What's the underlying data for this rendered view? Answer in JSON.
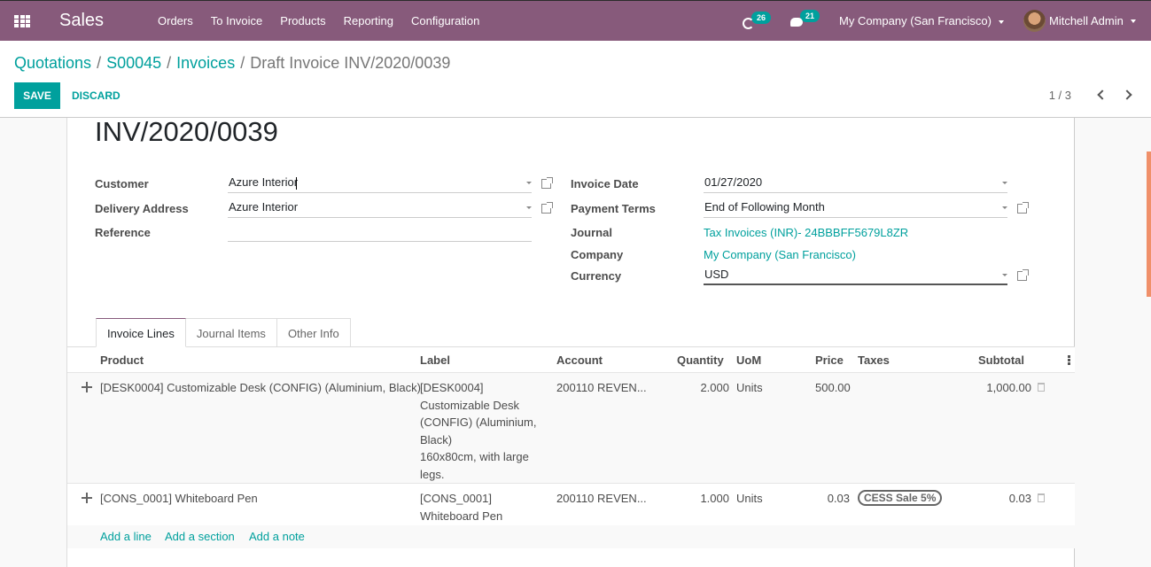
{
  "navbar": {
    "app_name": "Sales",
    "menu": [
      "Orders",
      "To Invoice",
      "Products",
      "Reporting",
      "Configuration"
    ],
    "activity_count": "26",
    "messages_count": "21",
    "company": "My Company (San Francisco)",
    "user": "Mitchell Admin"
  },
  "breadcrumb": {
    "items": [
      "Quotations",
      "S00045",
      "Invoices"
    ],
    "current": "Draft Invoice INV/2020/0039"
  },
  "toolbar": {
    "save_label": "SAVE",
    "discard_label": "DISCARD",
    "pager": "1 / 3"
  },
  "invoice": {
    "number": "INV/2020/0039",
    "left_fields": {
      "customer_label": "Customer",
      "customer_value": "Azure Interior",
      "delivery_label": "Delivery Address",
      "delivery_value": "Azure Interior",
      "reference_label": "Reference",
      "reference_value": ""
    },
    "right_fields": {
      "invoice_date_label": "Invoice Date",
      "invoice_date_value": "01/27/2020",
      "payment_terms_label": "Payment Terms",
      "payment_terms_value": "End of Following Month",
      "journal_label": "Journal",
      "journal_value": "Tax Invoices (INR)- 24BBBFF5679L8ZR",
      "company_label": "Company",
      "company_value": "My Company (San Francisco)",
      "currency_label": "Currency",
      "currency_value": "USD"
    }
  },
  "tabs": [
    "Invoice Lines",
    "Journal Items",
    "Other Info"
  ],
  "lines": {
    "columns": [
      "Product",
      "Label",
      "Account",
      "Quantity",
      "UoM",
      "Price",
      "Taxes",
      "Subtotal"
    ],
    "rows": [
      {
        "product": "[DESK0004] Customizable Desk (CONFIG) (Aluminium, Black)",
        "label_lines": [
          "[DESK0004]",
          "Customizable Desk",
          "(CONFIG) (Aluminium,",
          "Black)",
          "160x80cm, with large",
          "legs."
        ],
        "account": "200110 REVEN...",
        "quantity": "2.000",
        "uom": "Units",
        "price": "500.00",
        "taxes": "",
        "subtotal": "1,000.00"
      },
      {
        "product": "[CONS_0001] Whiteboard Pen",
        "label_lines": [
          "[CONS_0001]",
          "Whiteboard Pen"
        ],
        "account": "200110 REVEN...",
        "quantity": "1.000",
        "uom": "Units",
        "price": "0.03",
        "taxes": "CESS Sale 5%",
        "subtotal": "0.03"
      }
    ],
    "add_links": [
      "Add a line",
      "Add a section",
      "Add a note"
    ]
  },
  "colors": {
    "brand": "#875a7b",
    "accent": "#00a09d",
    "scrollbar": "#f0906a"
  }
}
